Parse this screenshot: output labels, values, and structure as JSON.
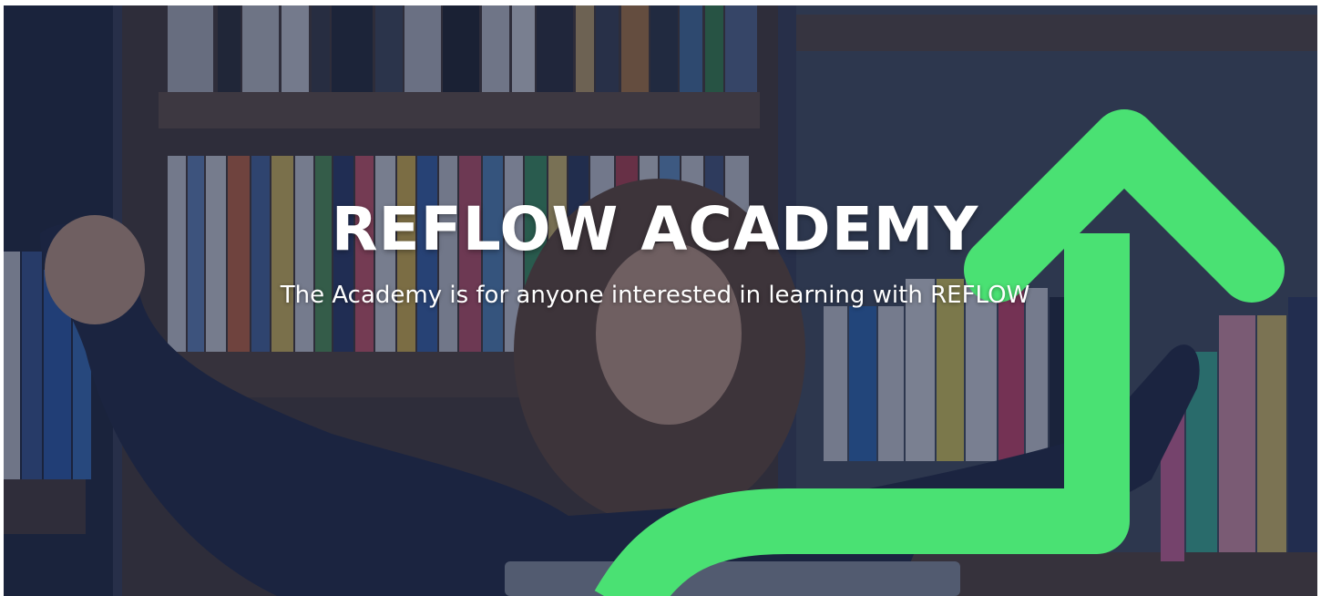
{
  "hero": {
    "title": "REFLOW ACADEMY",
    "subtitle": "The Academy is for anyone interested in learning with REFLOW"
  },
  "background": {
    "description_icon": "bookshelf-photo",
    "overlay_color": "#182240"
  },
  "arrow": {
    "icon": "growth-arrow-icon",
    "color": "#4ae173"
  }
}
